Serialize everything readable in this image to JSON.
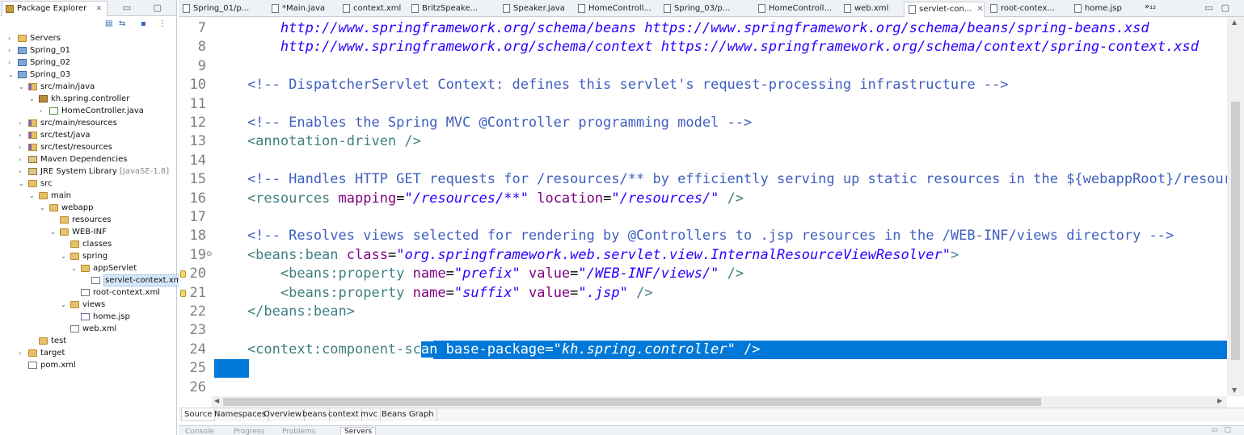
{
  "explorer": {
    "tab_label": "Package Explorer",
    "tab_close": "✕",
    "win_buttons": "▭ ▢",
    "tree": [
      {
        "label": "Servers",
        "deco": "",
        "indent": 0,
        "arrow": "›",
        "icon": "folder"
      },
      {
        "label": "Spring_01",
        "deco": "",
        "indent": 0,
        "arrow": "›",
        "icon": "project"
      },
      {
        "label": "Spring_02",
        "deco": "",
        "indent": 0,
        "arrow": "›",
        "icon": "project"
      },
      {
        "label": "Spring_03",
        "deco": "",
        "indent": 0,
        "arrow": "⌄",
        "icon": "project"
      },
      {
        "label": "src/main/java",
        "deco": "",
        "indent": 1,
        "arrow": "⌄",
        "icon": "src"
      },
      {
        "label": "kh.spring.controller",
        "deco": "",
        "indent": 2,
        "arrow": "⌄",
        "icon": "pkg"
      },
      {
        "label": "HomeController.java",
        "deco": "",
        "indent": 3,
        "arrow": "›",
        "icon": "java"
      },
      {
        "label": "src/main/resources",
        "deco": "",
        "indent": 1,
        "arrow": "›",
        "icon": "src"
      },
      {
        "label": "src/test/java",
        "deco": "",
        "indent": 1,
        "arrow": "›",
        "icon": "src"
      },
      {
        "label": "src/test/resources",
        "deco": "",
        "indent": 1,
        "arrow": "›",
        "icon": "src"
      },
      {
        "label": "Maven Dependencies",
        "deco": "",
        "indent": 1,
        "arrow": "›",
        "icon": "lib"
      },
      {
        "label": "JRE System Library",
        "deco": " [JavaSE-1.8]",
        "indent": 1,
        "arrow": "›",
        "icon": "lib"
      },
      {
        "label": "src",
        "deco": "",
        "indent": 1,
        "arrow": "⌄",
        "icon": "folder"
      },
      {
        "label": "main",
        "deco": "",
        "indent": 2,
        "arrow": "⌄",
        "icon": "folder"
      },
      {
        "label": "webapp",
        "deco": "",
        "indent": 3,
        "arrow": "⌄",
        "icon": "folder"
      },
      {
        "label": "resources",
        "deco": "",
        "indent": 4,
        "arrow": "",
        "icon": "folder"
      },
      {
        "label": "WEB-INF",
        "deco": "",
        "indent": 4,
        "arrow": "⌄",
        "icon": "folder"
      },
      {
        "label": "classes",
        "deco": "",
        "indent": 5,
        "arrow": "",
        "icon": "folder"
      },
      {
        "label": "spring",
        "deco": "",
        "indent": 5,
        "arrow": "⌄",
        "icon": "folder"
      },
      {
        "label": "appServlet",
        "deco": "",
        "indent": 6,
        "arrow": "⌄",
        "icon": "folder"
      },
      {
        "label": "servlet-context.xml",
        "deco": "",
        "indent": 7,
        "arrow": "",
        "icon": "xml",
        "selected": true
      },
      {
        "label": "root-context.xml",
        "deco": "",
        "indent": 6,
        "arrow": "",
        "icon": "xml"
      },
      {
        "label": "views",
        "deco": "",
        "indent": 5,
        "arrow": "⌄",
        "icon": "folder"
      },
      {
        "label": "home.jsp",
        "deco": "",
        "indent": 6,
        "arrow": "",
        "icon": "jsp"
      },
      {
        "label": "web.xml",
        "deco": "",
        "indent": 5,
        "arrow": "",
        "icon": "xml"
      },
      {
        "label": "test",
        "deco": "",
        "indent": 2,
        "arrow": "",
        "icon": "folder"
      },
      {
        "label": "target",
        "deco": "",
        "indent": 1,
        "arrow": "›",
        "icon": "folder"
      },
      {
        "label": "pom.xml",
        "deco": "",
        "indent": 1,
        "arrow": "",
        "icon": "xml"
      }
    ]
  },
  "editor_tabs": [
    {
      "label": "Spring_01/p..."
    },
    {
      "label": "*Main.java"
    },
    {
      "label": "context.xml"
    },
    {
      "label": "BritzSpeake..."
    },
    {
      "label": "Speaker.java"
    },
    {
      "label": "HomeControll..."
    },
    {
      "label": "Spring_03/p..."
    },
    {
      "label": "HomeControll..."
    },
    {
      "label": "web.xml"
    },
    {
      "label": "servlet-con...",
      "active": true,
      "close": "✕"
    },
    {
      "label": "root-contex..."
    },
    {
      "label": "home.jsp"
    }
  ],
  "editor_tabs_more": "»₁₂",
  "editor": {
    "lines": [
      {
        "n": "7",
        "html_parts": [
          {
            "c": "pl",
            "t": "        "
          },
          {
            "c": "url",
            "t": "http://www.springframework.org/schema/beans https://www.springframework.org/schema/beans/spring-beans.xsd"
          }
        ]
      },
      {
        "n": "8",
        "html_parts": [
          {
            "c": "pl",
            "t": "        "
          },
          {
            "c": "url",
            "t": "http://www.springframework.org/schema/context https://www.springframework.org/schema/context/spring-context.xsd"
          }
        ]
      },
      {
        "n": "9",
        "html_parts": []
      },
      {
        "n": "10",
        "html_parts": [
          {
            "c": "cmt",
            "t": "    <!-- DispatcherServlet Context: defines this servlet's request-processing infrastructure -->"
          }
        ]
      },
      {
        "n": "11",
        "html_parts": []
      },
      {
        "n": "12",
        "html_parts": [
          {
            "c": "cmt",
            "t": "    <!-- Enables the Spring MVC @Controller programming model -->"
          }
        ]
      },
      {
        "n": "13",
        "html_parts": [
          {
            "c": "tag",
            "t": "    <annotation-driven />"
          }
        ]
      },
      {
        "n": "14",
        "html_parts": []
      },
      {
        "n": "15",
        "html_parts": [
          {
            "c": "cmt",
            "t": "    <!-- Handles HTTP GET requests for /resources/** by efficiently serving up static resources in the ${webappRoot}/resources directory -->"
          }
        ]
      },
      {
        "n": "16",
        "html_parts": [
          {
            "c": "tag",
            "t": "    <resources "
          },
          {
            "c": "attr",
            "t": "mapping"
          },
          {
            "c": "pl",
            "t": "="
          },
          {
            "c": "val",
            "t": "\"/resources/**\""
          },
          {
            "c": "pl",
            "t": " "
          },
          {
            "c": "attr",
            "t": "location"
          },
          {
            "c": "pl",
            "t": "="
          },
          {
            "c": "val",
            "t": "\"/resources/\""
          },
          {
            "c": "tag",
            "t": " />"
          }
        ]
      },
      {
        "n": "17",
        "html_parts": []
      },
      {
        "n": "18",
        "html_parts": [
          {
            "c": "cmt",
            "t": "    <!-- Resolves views selected for rendering by @Controllers to .jsp resources in the /WEB-INF/views directory -->"
          }
        ]
      },
      {
        "n": "19",
        "fold": "⊖",
        "html_parts": [
          {
            "c": "tag",
            "t": "    <beans:bean "
          },
          {
            "c": "attr",
            "t": "class"
          },
          {
            "c": "pl",
            "t": "="
          },
          {
            "c": "val",
            "t": "\"org.springframework.web.servlet.view.InternalResourceViewResolver\""
          },
          {
            "c": "tag",
            "t": ">"
          }
        ]
      },
      {
        "n": "20",
        "mark": true,
        "html_parts": [
          {
            "c": "tag",
            "t": "        <beans:property "
          },
          {
            "c": "attr",
            "t": "name"
          },
          {
            "c": "pl",
            "t": "="
          },
          {
            "c": "val",
            "t": "\"prefix\""
          },
          {
            "c": "pl",
            "t": " "
          },
          {
            "c": "attr",
            "t": "value"
          },
          {
            "c": "pl",
            "t": "="
          },
          {
            "c": "val",
            "t": "\"/WEB-INF/views/\""
          },
          {
            "c": "tag",
            "t": " />"
          }
        ]
      },
      {
        "n": "21",
        "mark": true,
        "html_parts": [
          {
            "c": "tag",
            "t": "        <beans:property "
          },
          {
            "c": "attr",
            "t": "name"
          },
          {
            "c": "pl",
            "t": "="
          },
          {
            "c": "val",
            "t": "\"suffix\""
          },
          {
            "c": "pl",
            "t": " "
          },
          {
            "c": "attr",
            "t": "value"
          },
          {
            "c": "pl",
            "t": "="
          },
          {
            "c": "val",
            "t": "\".jsp\""
          },
          {
            "c": "tag",
            "t": " />"
          }
        ]
      },
      {
        "n": "22",
        "html_parts": [
          {
            "c": "tag",
            "t": "    </beans:bean>"
          }
        ]
      },
      {
        "n": "23",
        "html_parts": []
      },
      {
        "n": "24",
        "selrow": true,
        "html_parts": [
          {
            "c": "tag",
            "t": "    <context:component-sc"
          },
          {
            "c": "tag sel",
            "t": "an base-package="
          },
          {
            "c": "val sel",
            "t": "\"kh.spring.controller\""
          },
          {
            "c": "tag sel",
            "t": " />"
          }
        ]
      },
      {
        "n": "25",
        "selblock": true,
        "html_parts": []
      },
      {
        "n": "26",
        "html_parts": []
      }
    ]
  },
  "bottom_tabs": [
    {
      "label": "Source",
      "active": true
    },
    {
      "label": "Namespaces"
    },
    {
      "label": "Overview"
    },
    {
      "label": "beans"
    },
    {
      "label": "context"
    },
    {
      "label": "mvc"
    },
    {
      "label": "Beans Graph"
    }
  ],
  "view_tabs": [
    {
      "label": "Console"
    },
    {
      "label": "Progress"
    },
    {
      "label": "Problems"
    },
    {
      "label": "Servers",
      "active": true
    }
  ],
  "colors": {
    "selection": "#0078d7",
    "accent": "#3f7f7f"
  }
}
